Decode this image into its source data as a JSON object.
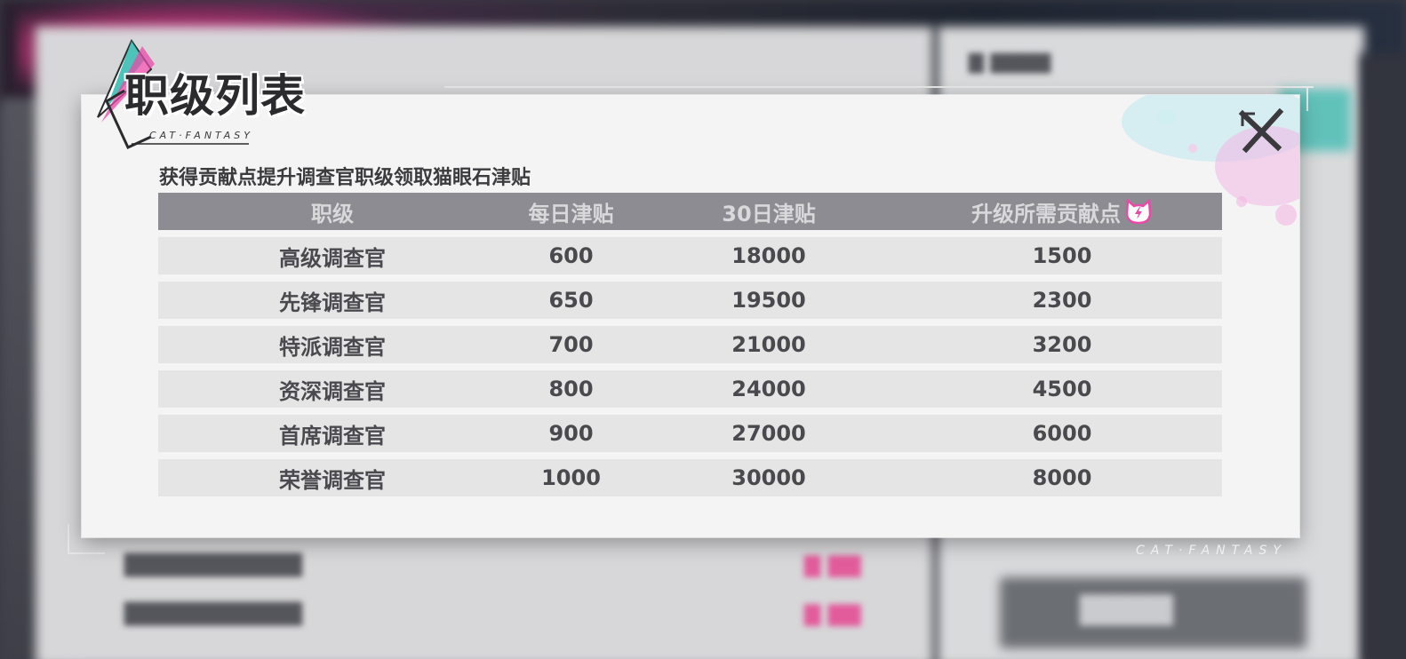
{
  "dialog": {
    "title": "职级列表",
    "title_sub": "CAT·FANTASY",
    "subtitle": "获得贡献点提升调查官职级领取猫眼石津贴",
    "close_icon": "close-x-icon",
    "brand_footer": "CAT·FANTASY"
  },
  "table": {
    "headers": {
      "rank": "职级",
      "daily": "每日津贴",
      "month": "30日津贴",
      "need": "升级所需贡献点",
      "need_icon": "cat-badge-icon"
    },
    "rows": [
      {
        "rank": "高级调查官",
        "daily": "600",
        "month": "18000",
        "need": "1500"
      },
      {
        "rank": "先锋调查官",
        "daily": "650",
        "month": "19500",
        "need": "2300"
      },
      {
        "rank": "特派调查官",
        "daily": "700",
        "month": "21000",
        "need": "3200"
      },
      {
        "rank": "资深调查官",
        "daily": "800",
        "month": "24000",
        "need": "4500"
      },
      {
        "rank": "首席调查官",
        "daily": "900",
        "month": "27000",
        "need": "6000"
      },
      {
        "rank": "荣誉调查官",
        "daily": "1000",
        "month": "30000",
        "need": "8000"
      }
    ]
  },
  "colors": {
    "header_bg": "#8c8c92",
    "row_bg": "#e5e5e6",
    "accent_pink": "#e94aa8",
    "accent_cyan": "#2fb8ad"
  }
}
